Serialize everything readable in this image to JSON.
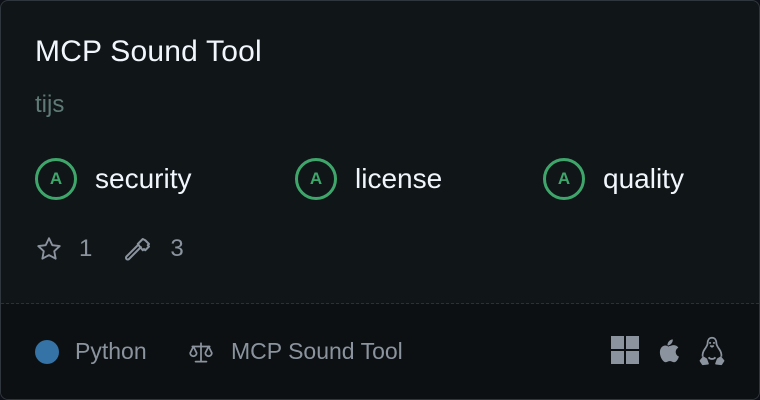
{
  "card": {
    "title": "MCP Sound Tool",
    "author": "tijs",
    "grades": [
      {
        "grade": "A",
        "label": "security"
      },
      {
        "grade": "A",
        "label": "license"
      },
      {
        "grade": "A",
        "label": "quality"
      }
    ],
    "stats": {
      "stars": "1",
      "tools": "3"
    },
    "footer": {
      "language": "Python",
      "language_color": "#3572a5",
      "license_name": "MCP Sound Tool",
      "platforms": [
        "windows-icon",
        "apple-icon",
        "linux-icon"
      ]
    }
  },
  "colors": {
    "background": "#101518",
    "footer_background": "#0c1013",
    "grade_green": "#3fa66b",
    "title_text": "#f0f6fc",
    "muted_text": "#8b949e",
    "author_text": "#5f7a76"
  }
}
